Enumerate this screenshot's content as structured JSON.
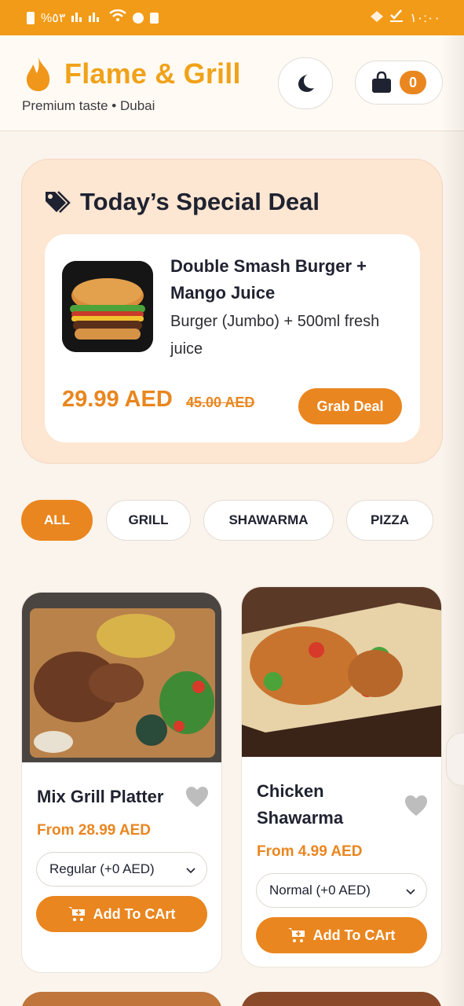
{
  "status_bar": {
    "left_text": "%٥٣",
    "right_text": "١٠:٠٠"
  },
  "header": {
    "brand": "Flame & Grill",
    "subtitle": "Premium taste • Dubai",
    "cart_count": "0"
  },
  "deal": {
    "heading": "Today’s Special Deal",
    "name": "Double Smash Burger + Mango Juice",
    "description": "Burger (Jumbo) + 500ml fresh juice",
    "price": "29.99 AED",
    "old_price": "45.00 AED",
    "button": "Grab Deal"
  },
  "categories": [
    "ALL",
    "GRILL",
    "SHAWARMA",
    "PIZZA"
  ],
  "products": [
    {
      "name": "Mix Grill Platter",
      "price": "From 28.99 AED",
      "option": "Regular (+0 AED)",
      "button": "Add To CArt"
    },
    {
      "name": "Chicken Shawarma",
      "price": "From 4.99 AED",
      "option": "Normal (+0 AED)",
      "button": "Add To CArt"
    }
  ],
  "colors": {
    "accent": "#e9861f",
    "brand": "#f0a21a",
    "status_bar": "#f29b18"
  }
}
